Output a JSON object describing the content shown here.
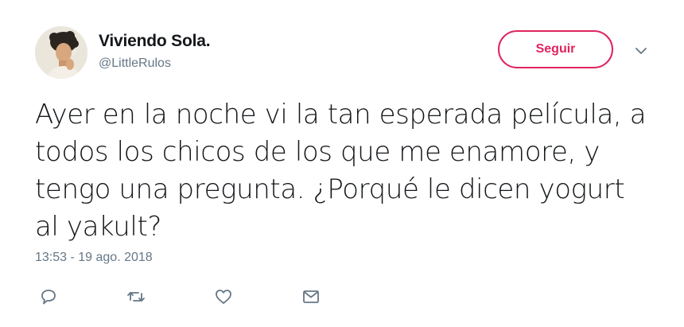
{
  "tweet": {
    "author": {
      "display_name": "Viviendo Sola.",
      "handle": "@LittleRulos",
      "avatar_icon": "profile-avatar-illustration"
    },
    "follow_label": "Seguir",
    "text": "Ayer en la noche vi la tan esperada película, a\ntodos los chicos de los que me enamore, y\ntengo una pregunta. ¿Porqué le dicen yogurt\nal yakult?",
    "timestamp": "13:53 - 19 ago. 2018",
    "actions": [
      {
        "name": "reply",
        "icon": "speech-bubble-icon"
      },
      {
        "name": "retweet",
        "icon": "retweet-arrows-icon"
      },
      {
        "name": "like",
        "icon": "heart-icon"
      },
      {
        "name": "direct-message",
        "icon": "envelope-icon"
      }
    ]
  },
  "colors": {
    "accent": "#e0245e",
    "text_primary": "#14171a",
    "text_secondary": "#657786"
  }
}
